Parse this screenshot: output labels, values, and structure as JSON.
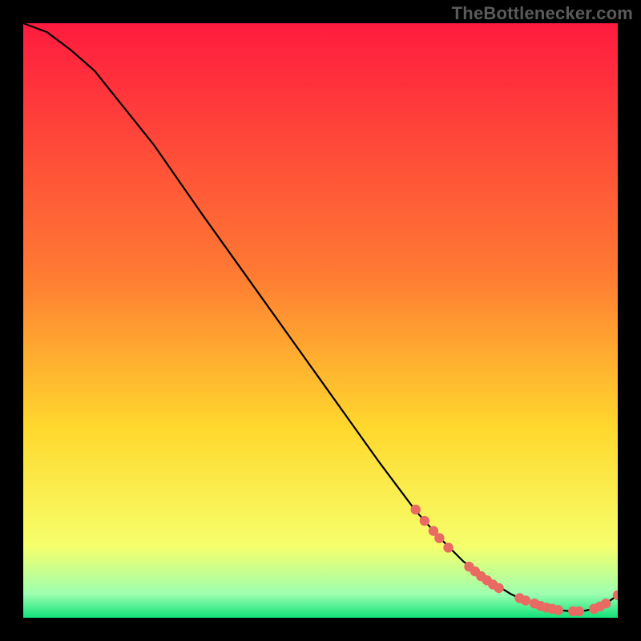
{
  "watermark": "TheBottlenecker.com",
  "colors": {
    "bg": "#000000",
    "curve": "#000000",
    "marker": "#e86a62",
    "grad_top": "#ff1b3f",
    "grad_mid1": "#ff7a33",
    "grad_mid2": "#ffd82d",
    "grad_low1": "#f6ff6b",
    "grad_low2": "#9dffb0",
    "grad_bottom": "#11e27a"
  },
  "chart_data": {
    "type": "line",
    "title": "",
    "xlabel": "",
    "ylabel": "",
    "xlim": [
      0,
      100
    ],
    "ylim": [
      0,
      100
    ],
    "curve": {
      "x": [
        0,
        4,
        8,
        12,
        16,
        22,
        30,
        40,
        50,
        60,
        66,
        70,
        74,
        78,
        82,
        85,
        88,
        90,
        92,
        94,
        96,
        98,
        100
      ],
      "y": [
        100,
        98.5,
        95.5,
        92,
        87,
        79.5,
        68,
        54,
        40,
        26,
        18,
        13.5,
        9.5,
        6.5,
        4,
        2.6,
        1.7,
        1.3,
        1.1,
        1.1,
        1.5,
        2.4,
        3.8
      ]
    },
    "markers": {
      "x": [
        66,
        67.5,
        69,
        70,
        71.5,
        75,
        76,
        77,
        78,
        79,
        80,
        83.5,
        84.5,
        86,
        87,
        88,
        89,
        90,
        92.5,
        93.5,
        96,
        97,
        98,
        100
      ],
      "y": [
        18.2,
        16.3,
        14.6,
        13.4,
        11.8,
        8.6,
        7.8,
        7,
        6.3,
        5.6,
        5,
        3.3,
        2.9,
        2.4,
        2,
        1.7,
        1.5,
        1.3,
        1.1,
        1.1,
        1.5,
        1.9,
        2.4,
        3.8
      ]
    }
  }
}
